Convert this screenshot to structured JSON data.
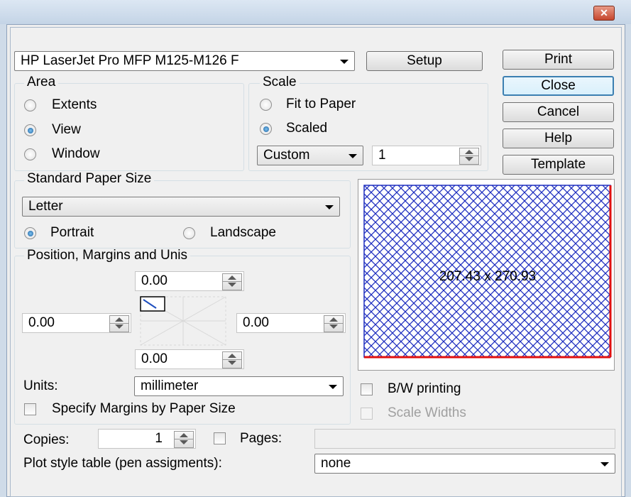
{
  "titlebar": {
    "close_glyph": "✕"
  },
  "printer": {
    "selected": "HP LaserJet Pro MFP M125-M126 F",
    "setup_label": "Setup"
  },
  "buttons": {
    "print": "Print",
    "close": "Close",
    "cancel": "Cancel",
    "help": "Help",
    "template": "Template"
  },
  "area": {
    "title": "Area",
    "options": [
      "Extents",
      "View",
      "Window"
    ],
    "selected": "View"
  },
  "scale": {
    "title": "Scale",
    "fit_label": "Fit to Paper",
    "scaled_label": "Scaled",
    "selected": "Scaled",
    "mode": "Custom",
    "value": "1"
  },
  "paper": {
    "title": "Standard Paper Size",
    "size": "Letter",
    "portrait": "Portrait",
    "landscape": "Landscape",
    "orientation": "Portrait"
  },
  "margins": {
    "title": "Position, Margins and Unis",
    "top": "0.00",
    "left": "0.00",
    "right": "0.00",
    "bottom": "0.00",
    "units_label": "Units:",
    "units_value": "millimeter",
    "specify_label": "Specify Margins by Paper Size"
  },
  "preview": {
    "dimensions": "207.43 x 270.93",
    "colors": {
      "hatch": "#1f2fbf",
      "border": "#e01010"
    }
  },
  "options": {
    "bw_label": "B/W printing",
    "scale_widths_label": "Scale Widths"
  },
  "copies": {
    "label": "Copies:",
    "value": "1",
    "pages_label": "Pages:",
    "pages_value": ""
  },
  "plot_style": {
    "label": "Plot style table (pen assigments):",
    "value": "none"
  }
}
